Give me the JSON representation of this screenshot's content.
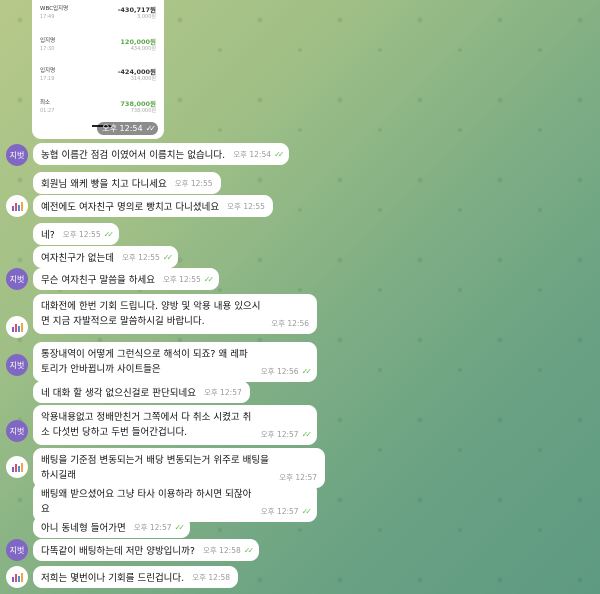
{
  "card": {
    "rows": [
      {
        "name": "WBC입지명",
        "amount": "-430,717원",
        "sub": "17:49",
        "balance": "3,000원",
        "type": "neg"
      },
      {
        "name": "입지명",
        "amount": "120,000원",
        "sub": "17:30",
        "balance": "434,000원",
        "type": "pos"
      },
      {
        "name": "입지명",
        "amount": "-424,000원",
        "sub": "17:19",
        "balance": "314,000원",
        "type": "neg"
      },
      {
        "name": "최소",
        "amount": "738,000원",
        "sub": "01:27",
        "balance": "738,000원",
        "type": "pos"
      }
    ],
    "time": "오후 12:54"
  },
  "messages": [
    {
      "sender": "지벗",
      "avatar": "지벗",
      "text": "농협 이름간 점검 이였어서 이름치는 없습니다.",
      "time": "오후 12:54",
      "read": true
    },
    {
      "sender": "other",
      "text": "회원님 왜케 빵을 치고 다니세요",
      "time": "오후 12:55",
      "read": false
    },
    {
      "sender": "other",
      "text": "예전에도 여자친구 명의로 빵치고 다니셨네요",
      "time": "오후 12:55",
      "read": false
    },
    {
      "sender": "me",
      "text": "네?",
      "time": "오후 12:55",
      "read": true
    },
    {
      "sender": "me",
      "text": "여자친구가 없는데",
      "time": "오후 12:55",
      "read": true
    },
    {
      "sender": "지벗",
      "avatar": "지벗",
      "text": "무슨 여자친구 말씀을 하세요",
      "time": "오후 12:55",
      "read": true
    },
    {
      "sender": "other",
      "text": "대화전에 한번 기회 드립니다. 양방 및 악용 내용 있으시면 지금 자발적으로 말씀하시길 바랍니다.",
      "time": "오후 12:56",
      "read": false
    },
    {
      "sender": "지벗",
      "avatar": "지벗",
      "text": "통장내역이 어떻게 그런식으로 해석이 되죠? 왜 레파토리가 안바뀝니까 사이트들은",
      "time": "오후 12:56",
      "read": true
    },
    {
      "sender": "other",
      "text": "네 대화 할 생각 없으신걸로 판단되네요",
      "time": "오후 12:57",
      "read": false
    },
    {
      "sender": "지벗",
      "avatar": "지벗",
      "text": "악용내용없고 정배만친거 그쪽에서 다 취소 시켰고 취소 다섯번 당하고 두번 들어간겁니다.",
      "time": "오후 12:57",
      "read": true
    },
    {
      "sender": "other",
      "text": "배팅을 기준점 변동되는거 배당 변동되는거 위주로 배팅을 하시길래",
      "time": "오후 12:57",
      "read": false
    },
    {
      "sender": "me",
      "text": "배팅왜 받으셨어요 그냥 타사 이용하라 하시면 되잖아요",
      "time": "오후 12:57",
      "read": true
    },
    {
      "sender": "me",
      "text": "아니 동네형 들어가면",
      "time": "오후 12:57",
      "read": true
    },
    {
      "sender": "지벗",
      "avatar": "지벗",
      "text": "다똑같이 배팅하는데 저만 양방입니까?",
      "time": "오후 12:58",
      "read": true
    },
    {
      "sender": "other",
      "text": "저희는 몇번이나 기회를 드린겁니다.",
      "time": "오후 12:58",
      "read": false
    }
  ],
  "colors": {
    "accent": "#6cbc5b",
    "avatar": "#8067c4"
  }
}
